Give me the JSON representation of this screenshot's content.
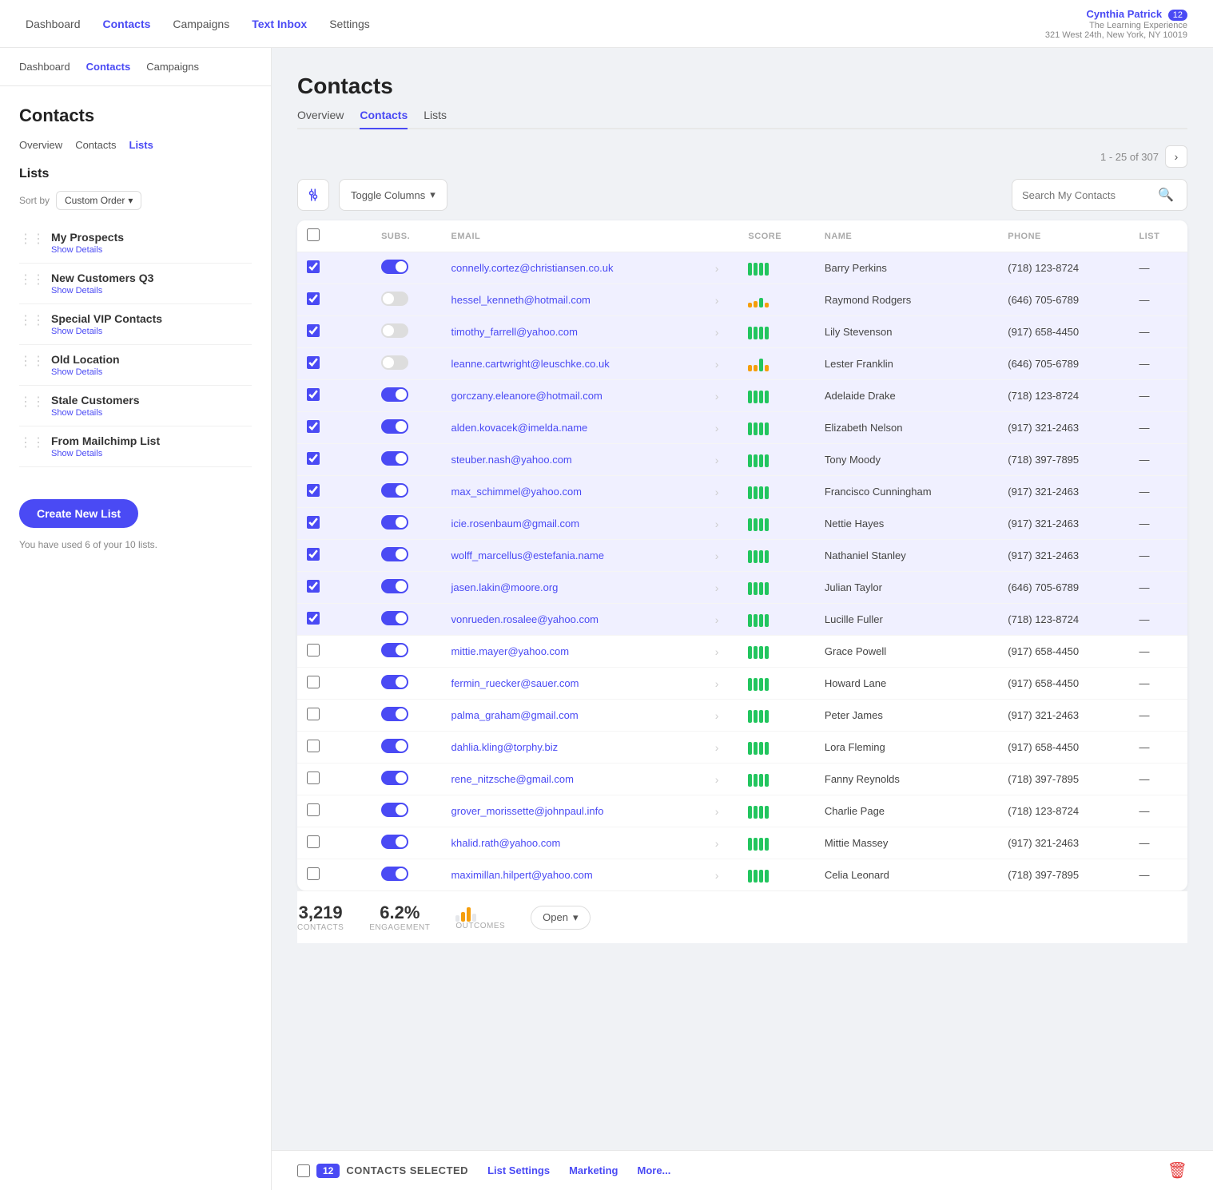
{
  "topNav": {
    "links": [
      {
        "label": "Dashboard",
        "active": false,
        "href": "#"
      },
      {
        "label": "Contacts",
        "active": true,
        "href": "#"
      },
      {
        "label": "Campaigns",
        "active": false,
        "href": "#"
      },
      {
        "label": "Text Inbox",
        "active": false,
        "href": "#",
        "highlight": true
      },
      {
        "label": "Settings",
        "active": false,
        "href": "#"
      }
    ],
    "user": {
      "name": "Cynthia Patrick",
      "badge": "12",
      "company": "The Learning Experience",
      "address": "321 West 24th, New York, NY 10019"
    }
  },
  "sidebar": {
    "navLinks": [
      {
        "label": "Dashboard",
        "active": false
      },
      {
        "label": "Contacts",
        "active": true
      },
      {
        "label": "Campaigns",
        "active": false
      }
    ],
    "title": "Contacts",
    "tabs": [
      {
        "label": "Overview",
        "active": false
      },
      {
        "label": "Contacts",
        "active": false
      },
      {
        "label": "Lists",
        "active": true
      }
    ],
    "listsTitle": "Lists",
    "sortLabel": "Sort by",
    "sortValue": "Custom Order",
    "lists": [
      {
        "name": "My Prospects",
        "detail": "Show Details"
      },
      {
        "name": "New Customers Q3",
        "detail": "Show Details"
      },
      {
        "name": "Special VIP Contacts",
        "detail": "Show Details"
      },
      {
        "name": "Old Location",
        "detail": "Show Details"
      },
      {
        "name": "Stale Customers",
        "detail": "Show Details"
      },
      {
        "name": "From Mailchimp List",
        "detail": "Show Details"
      }
    ],
    "createBtn": "Create New List",
    "quota": "You have used 6 of your 10 lists."
  },
  "main": {
    "title": "Contacts",
    "tabs": [
      {
        "label": "Overview",
        "active": false
      },
      {
        "label": "Contacts",
        "active": true
      },
      {
        "label": "Lists",
        "active": false
      }
    ],
    "pagination": {
      "text": "1 - 25 of 307"
    },
    "toolbar": {
      "toggleColumns": "Toggle Columns",
      "searchPlaceholder": "Search My Contacts"
    },
    "table": {
      "headers": [
        "",
        "SUBS.",
        "EMAIL",
        "",
        "SCORE",
        "NAME",
        "PHONE",
        "LIST"
      ],
      "rows": [
        {
          "checked": true,
          "subscribed": true,
          "email": "connelly.cortez@christiansen.co.uk",
          "score": [
            4,
            4,
            4,
            4
          ],
          "name": "Barry Perkins",
          "phone": "(718) 123-8724",
          "list": "—"
        },
        {
          "checked": true,
          "subscribed": false,
          "email": "hessel_kenneth@hotmail.com",
          "score": [
            1,
            2,
            3,
            1
          ],
          "name": "Raymond Rodgers",
          "phone": "(646) 705-6789",
          "list": "—"
        },
        {
          "checked": true,
          "subscribed": false,
          "email": "timothy_farrell@yahoo.com",
          "score": [
            4,
            4,
            4,
            4
          ],
          "name": "Lily Stevenson",
          "phone": "(917) 658-4450",
          "list": "—"
        },
        {
          "checked": true,
          "subscribed": false,
          "email": "leanne.cartwright@leuschke.co.uk",
          "score": [
            2,
            2,
            4,
            2
          ],
          "name": "Lester Franklin",
          "phone": "(646) 705-6789",
          "list": "—"
        },
        {
          "checked": true,
          "subscribed": true,
          "email": "gorczany.eleanore@hotmail.com",
          "score": [
            4,
            4,
            4,
            4
          ],
          "name": "Adelaide Drake",
          "phone": "(718) 123-8724",
          "list": "—"
        },
        {
          "checked": true,
          "subscribed": true,
          "email": "alden.kovacek@imelda.name",
          "score": [
            4,
            4,
            4,
            4
          ],
          "name": "Elizabeth Nelson",
          "phone": "(917) 321-2463",
          "list": "—"
        },
        {
          "checked": true,
          "subscribed": true,
          "email": "steuber.nash@yahoo.com",
          "score": [
            4,
            4,
            4,
            4
          ],
          "name": "Tony Moody",
          "phone": "(718) 397-7895",
          "list": "—"
        },
        {
          "checked": true,
          "subscribed": true,
          "email": "max_schimmel@yahoo.com",
          "score": [
            4,
            4,
            4,
            4
          ],
          "name": "Francisco Cunningham",
          "phone": "(917) 321-2463",
          "list": "—"
        },
        {
          "checked": true,
          "subscribed": true,
          "email": "icie.rosenbaum@gmail.com",
          "score": [
            4,
            4,
            4,
            4
          ],
          "name": "Nettie Hayes",
          "phone": "(917) 321-2463",
          "list": "—"
        },
        {
          "checked": true,
          "subscribed": true,
          "email": "wolff_marcellus@estefania.name",
          "score": [
            4,
            4,
            4,
            4
          ],
          "name": "Nathaniel Stanley",
          "phone": "(917) 321-2463",
          "list": "—"
        },
        {
          "checked": true,
          "subscribed": true,
          "email": "jasen.lakin@moore.org",
          "score": [
            4,
            4,
            4,
            4
          ],
          "name": "Julian Taylor",
          "phone": "(646) 705-6789",
          "list": "—"
        },
        {
          "checked": true,
          "subscribed": true,
          "email": "vonrueden.rosalee@yahoo.com",
          "score": [
            4,
            4,
            4,
            4
          ],
          "name": "Lucille Fuller",
          "phone": "(718) 123-8724",
          "list": "—"
        },
        {
          "checked": false,
          "subscribed": true,
          "email": "mittie.mayer@yahoo.com",
          "score": [
            4,
            4,
            4,
            4
          ],
          "name": "Grace Powell",
          "phone": "(917) 658-4450",
          "list": "—"
        },
        {
          "checked": false,
          "subscribed": true,
          "email": "fermin_ruecker@sauer.com",
          "score": [
            4,
            4,
            4,
            4
          ],
          "name": "Howard Lane",
          "phone": "(917) 658-4450",
          "list": "—"
        },
        {
          "checked": false,
          "subscribed": true,
          "email": "palma_graham@gmail.com",
          "score": [
            4,
            4,
            4,
            4
          ],
          "name": "Peter James",
          "phone": "(917) 321-2463",
          "list": "—"
        },
        {
          "checked": false,
          "subscribed": true,
          "email": "dahlia.kling@torphy.biz",
          "score": [
            4,
            4,
            4,
            4
          ],
          "name": "Lora Fleming",
          "phone": "(917) 658-4450",
          "list": "—"
        },
        {
          "checked": false,
          "subscribed": true,
          "email": "rene_nitzsche@gmail.com",
          "score": [
            4,
            4,
            4,
            4
          ],
          "name": "Fanny Reynolds",
          "phone": "(718) 397-7895",
          "list": "—"
        },
        {
          "checked": false,
          "subscribed": true,
          "email": "grover_morissette@johnpaul.info",
          "score": [
            4,
            4,
            4,
            4
          ],
          "name": "Charlie Page",
          "phone": "(718) 123-8724",
          "list": "—"
        },
        {
          "checked": false,
          "subscribed": true,
          "email": "khalid.rath@yahoo.com",
          "score": [
            4,
            4,
            4,
            4
          ],
          "name": "Mittie Massey",
          "phone": "(917) 321-2463",
          "list": "—"
        },
        {
          "checked": false,
          "subscribed": true,
          "email": "maximillan.hilpert@yahoo.com",
          "score": [
            4,
            4,
            4,
            4
          ],
          "name": "Celia Leonard",
          "phone": "(718) 397-7895",
          "list": "—"
        }
      ]
    },
    "bottomBar": {
      "selectedCount": "12",
      "selectedLabel": "CONTACTS SELECTED",
      "listSettings": "List Settings",
      "marketing": "Marketing",
      "more": "More..."
    },
    "stats": {
      "contacts": "3,219",
      "contactsLabel": "CONTACTS",
      "engagement": "6.2%",
      "engagementLabel": "ENGAGEMENT",
      "outcomesLabel": "OUTCOMES",
      "openBtn": "Open"
    }
  }
}
